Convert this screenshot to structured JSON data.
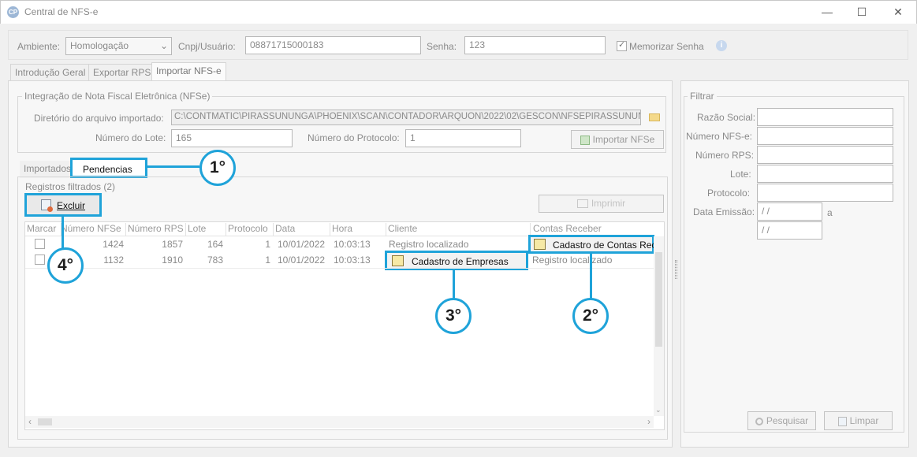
{
  "window": {
    "title": "Central de NFS-e",
    "app_icon": "CP"
  },
  "top": {
    "ambiente_label": "Ambiente:",
    "ambiente_value": "Homologação",
    "cnpj_label": "Cnpj/Usuário:",
    "cnpj_value": "08871715000183",
    "senha_label": "Senha:",
    "senha_value": "123",
    "memorizar_label": "Memorizar Senha"
  },
  "tabs": [
    "Introdução Geral",
    "Exportar RPS",
    "Importar NFS-e"
  ],
  "integracao": {
    "group_title": "Integração de Nota Fiscal Eletrônica (NFSe)",
    "dir_label": "Diretório do arquivo importado:",
    "dir_value": "C:\\CONTMATIC\\PIRASSUNUNGA\\PHOENIX\\SCAN\\CONTADOR\\ARQUON\\2022\\02\\GESCON\\NFSEPIRASSUNUN",
    "lote_label": "Número do Lote:",
    "lote_value": "165",
    "protocolo_label": "Número do Protocolo:",
    "protocolo_value": "1",
    "importar_label": "Importar NFSe"
  },
  "subtabs": [
    "Importados",
    "Pendencias"
  ],
  "registros": {
    "group_title": "Registros filtrados (2)",
    "excluir_label": "Excluir",
    "imprimir_label": "Imprimir",
    "columns": [
      "Marcar",
      "Número NFSe",
      "Número RPS",
      "Lote",
      "Protocolo",
      "Data",
      "Hora",
      "Cliente",
      "Contas Receber"
    ],
    "rows": [
      {
        "nfse": "1424",
        "rps": "1857",
        "lote": "164",
        "protocolo": "1",
        "data": "10/01/2022",
        "hora": "10:03:13",
        "cliente": "Registro localizado",
        "contas": "Cadastro de Contas Rec"
      },
      {
        "nfse": "1132",
        "rps": "1910",
        "lote": "783",
        "protocolo": "1",
        "data": "10/01/2022",
        "hora": "10:03:13",
        "cliente": "Cadastro de Empresas",
        "contas": "Registro localizado"
      }
    ]
  },
  "filtrar": {
    "group_title": "Filtrar",
    "razao_label": "Razão Social:",
    "nfse_label": "Número NFS-e:",
    "rps_label": "Número RPS:",
    "lote_label": "Lote:",
    "protocolo_label": "Protocolo:",
    "data_label": "Data Emissão:",
    "data_from": " / /",
    "data_a": "a",
    "data_to": " / /",
    "pesquisar_label": "Pesquisar",
    "limpar_label": "Limpar"
  },
  "callouts": [
    "1°",
    "2°",
    "3°",
    "4°"
  ],
  "colors": {
    "callout_blue": "#1fa3d9"
  }
}
